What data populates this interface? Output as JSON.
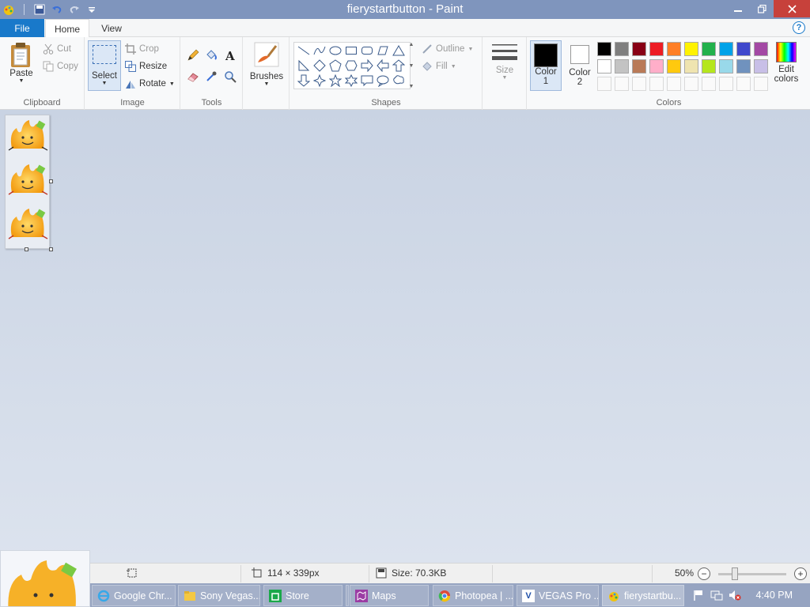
{
  "window": {
    "title": "fierystartbutton - Paint"
  },
  "menu": {
    "file": "File",
    "tabs": [
      "Home",
      "View"
    ],
    "help": "?"
  },
  "ribbon": {
    "clipboard": {
      "label": "Clipboard",
      "paste": "Paste",
      "cut": "Cut",
      "copy": "Copy"
    },
    "image": {
      "label": "Image",
      "select": "Select",
      "crop": "Crop",
      "resize": "Resize",
      "rotate": "Rotate"
    },
    "tools": {
      "label": "Tools"
    },
    "brushes": {
      "label": "Brushes"
    },
    "shapes": {
      "label": "Shapes",
      "outline": "Outline",
      "fill": "Fill"
    },
    "size": {
      "label": "Size"
    },
    "colors": {
      "label": "Colors",
      "color1": [
        "Color",
        "1"
      ],
      "color2": [
        "Color",
        "2"
      ],
      "edit": [
        "Edit",
        "colors"
      ],
      "color1_value": "#000000",
      "color2_value": "#ffffff",
      "palette_row1": [
        "#000000",
        "#7f7f7f",
        "#880015",
        "#ed1c24",
        "#ff7f27",
        "#fff200",
        "#22b14c",
        "#00a2e8",
        "#3f48cc",
        "#a349a4"
      ],
      "palette_row2": [
        "#ffffff",
        "#c3c3c3",
        "#b97a57",
        "#ffaec9",
        "#ffc90e",
        "#efe4b0",
        "#b5e61d",
        "#99d9ea",
        "#7092be",
        "#c8bfe7"
      ]
    }
  },
  "status": {
    "dimensions": "114 × 339px",
    "size": "Size: 70.3KB",
    "zoom": "50%",
    "zoom_value_percent": 50
  },
  "taskbar": {
    "items": [
      {
        "label": "Google Chr...",
        "icon": "ie-icon"
      },
      {
        "label": "Sony Vegas...",
        "icon": "folder-icon"
      },
      {
        "label": "Store",
        "icon": "store-icon"
      },
      {
        "label": "",
        "icon": "blank"
      },
      {
        "label": "Maps",
        "icon": "maps-icon"
      },
      {
        "label": "Photopea | ...",
        "icon": "chrome-icon"
      },
      {
        "label": "VEGAS Pro ...",
        "icon": "vegas-icon"
      },
      {
        "label": "fierystartbu...",
        "icon": "paint-icon"
      }
    ],
    "clock": "4:40 PM"
  },
  "colors": {
    "titlebar": "#7f95bd",
    "accent": "#1979ca",
    "close": "#c7413b"
  }
}
